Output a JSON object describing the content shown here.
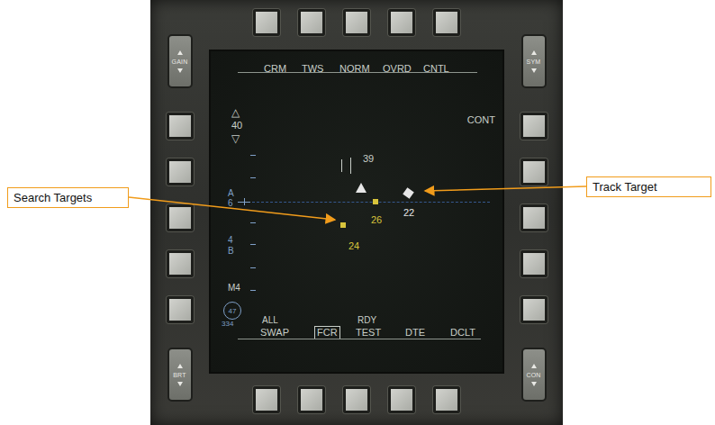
{
  "callouts": {
    "search": "Search Targets",
    "track": "Track Target"
  },
  "bezel": {
    "top_left": "GAIN",
    "top_right": "SYM",
    "bottom_left": "BRT",
    "bottom_right": "CON"
  },
  "display": {
    "top_options": [
      {
        "label": "CRM",
        "selected": false
      },
      {
        "label": "TWS",
        "selected": false
      },
      {
        "label": "NORM",
        "selected": false
      },
      {
        "label": "OVRD",
        "selected": false
      },
      {
        "label": "CNTL",
        "selected": false
      }
    ],
    "mode_right": "CONT",
    "elevation": {
      "up": "△",
      "value": "40",
      "down": "▽"
    },
    "azimuth_scale": [
      "A",
      "6"
    ],
    "bar_scale": [
      "4",
      "B"
    ],
    "mach": "M4",
    "heading": {
      "value": "47",
      "bearing": "334"
    },
    "altitude_marker": "39",
    "bottom_options": [
      {
        "label": "SWAP",
        "above": "ALL",
        "selected": false
      },
      {
        "label": "FCR",
        "selected": true
      },
      {
        "label": "TEST",
        "above": "RDY",
        "selected": false
      },
      {
        "label": "DTE",
        "selected": false
      },
      {
        "label": "DCLT",
        "selected": false
      }
    ],
    "targets": [
      {
        "kind": "search",
        "altitude": "26",
        "color": "#d8c43c"
      },
      {
        "kind": "search",
        "altitude": "24",
        "color": "#d8c43c"
      },
      {
        "kind": "track",
        "altitude": "22",
        "color": "#e6e6e6"
      }
    ]
  }
}
